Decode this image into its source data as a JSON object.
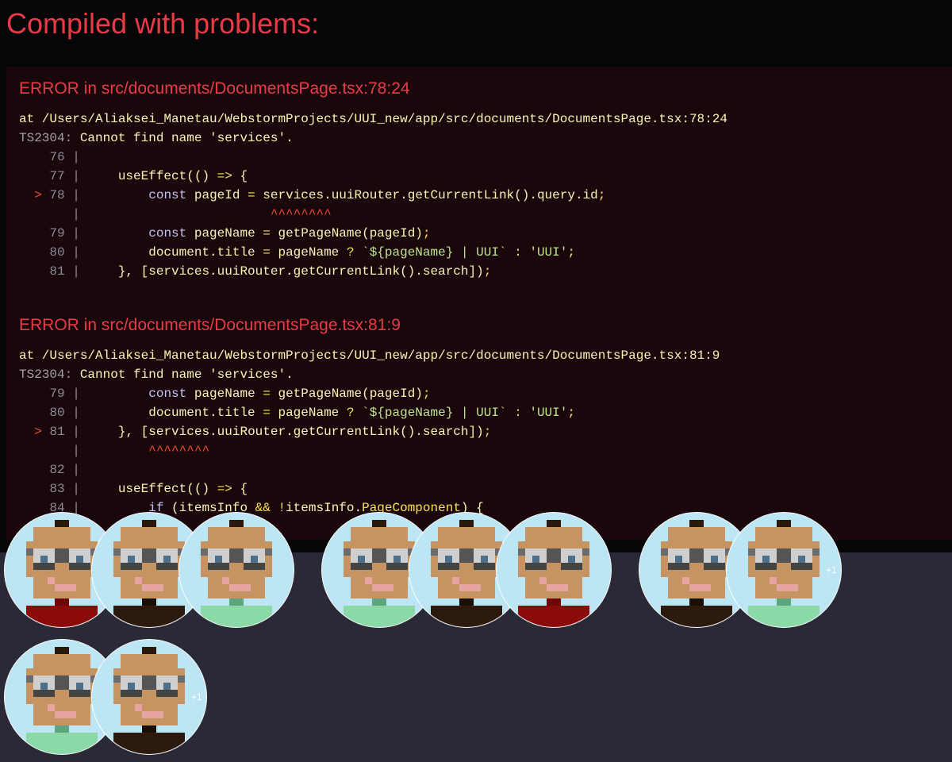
{
  "overlay": {
    "title": "Compiled with problems:",
    "errors": [
      {
        "heading": "ERROR in src/documents/DocumentsPage.tsx:78:24",
        "location": "at /Users/Aliaksei_Manetau/WebstormProjects/UUI_new/app/src/documents/DocumentsPage.tsx:78:24",
        "code": "TS2304:",
        "message": " Cannot find name 'services'.",
        "lines": [
          {
            "gutter": "    76 |",
            "segments": []
          },
          {
            "gutter": "    77 |",
            "segments": [
              {
                "t": "     useEffect(() ",
                "c": "text"
              },
              {
                "t": "=>",
                "c": "op"
              },
              {
                "t": " {",
                "c": "text"
              }
            ]
          },
          {
            "gutter": "  > 78 |",
            "marker": true,
            "segments": [
              {
                "t": "         ",
                "c": "text"
              },
              {
                "t": "const",
                "c": "kw"
              },
              {
                "t": " pageId ",
                "c": "text"
              },
              {
                "t": "=",
                "c": "op"
              },
              {
                "t": " services.uuiRouter.getCurrentLink().query.id",
                "c": "text"
              },
              {
                "t": ";",
                "c": "op"
              }
            ]
          },
          {
            "gutter": "       |",
            "segments": [
              {
                "t": "                         ^^^^^^^^",
                "c": "mark"
              }
            ]
          },
          {
            "gutter": "    79 |",
            "segments": [
              {
                "t": "         ",
                "c": "text"
              },
              {
                "t": "const",
                "c": "kw"
              },
              {
                "t": " pageName ",
                "c": "text"
              },
              {
                "t": "=",
                "c": "op"
              },
              {
                "t": " getPageName(pageId)",
                "c": "text"
              },
              {
                "t": ";",
                "c": "op"
              }
            ]
          },
          {
            "gutter": "    80 |",
            "segments": [
              {
                "t": "         document.title ",
                "c": "text"
              },
              {
                "t": "=",
                "c": "op"
              },
              {
                "t": " pageName ",
                "c": "text"
              },
              {
                "t": "?",
                "c": "op"
              },
              {
                "t": " ",
                "c": "text"
              },
              {
                "t": "`${pageName} | UUI`",
                "c": "str"
              },
              {
                "t": " : ",
                "c": "op"
              },
              {
                "t": "'UUI'",
                "c": "str"
              },
              {
                "t": ";",
                "c": "op"
              }
            ]
          },
          {
            "gutter": "    81 |",
            "segments": [
              {
                "t": "     }, [services.uuiRouter.getCurrentLink().search])",
                "c": "text"
              },
              {
                "t": ";",
                "c": "op"
              }
            ]
          }
        ]
      },
      {
        "heading": "ERROR in src/documents/DocumentsPage.tsx:81:9",
        "location": "at /Users/Aliaksei_Manetau/WebstormProjects/UUI_new/app/src/documents/DocumentsPage.tsx:81:9",
        "code": "TS2304:",
        "message": " Cannot find name 'services'.",
        "lines": [
          {
            "gutter": "    79 |",
            "segments": [
              {
                "t": "         ",
                "c": "text"
              },
              {
                "t": "const",
                "c": "kw"
              },
              {
                "t": " pageName ",
                "c": "text"
              },
              {
                "t": "=",
                "c": "op"
              },
              {
                "t": " getPageName(pageId)",
                "c": "text"
              },
              {
                "t": ";",
                "c": "op"
              }
            ]
          },
          {
            "gutter": "    80 |",
            "segments": [
              {
                "t": "         document.title ",
                "c": "text"
              },
              {
                "t": "=",
                "c": "op"
              },
              {
                "t": " pageName ",
                "c": "text"
              },
              {
                "t": "?",
                "c": "op"
              },
              {
                "t": " ",
                "c": "text"
              },
              {
                "t": "`${pageName} | UUI`",
                "c": "str"
              },
              {
                "t": " : ",
                "c": "op"
              },
              {
                "t": "'UUI'",
                "c": "str"
              },
              {
                "t": ";",
                "c": "op"
              }
            ]
          },
          {
            "gutter": "  > 81 |",
            "marker": true,
            "segments": [
              {
                "t": "     }, [services.uuiRouter.getCurrentLink().search])",
                "c": "text"
              },
              {
                "t": ";",
                "c": "op"
              }
            ]
          },
          {
            "gutter": "       |",
            "segments": [
              {
                "t": "         ^^^^^^^^",
                "c": "mark"
              }
            ]
          },
          {
            "gutter": "    82 |",
            "segments": []
          },
          {
            "gutter": "    83 |",
            "segments": [
              {
                "t": "     useEffect(() ",
                "c": "text"
              },
              {
                "t": "=>",
                "c": "op"
              },
              {
                "t": " {",
                "c": "text"
              }
            ]
          },
          {
            "gutter": "    84 |",
            "segments": [
              {
                "t": "         ",
                "c": "text"
              },
              {
                "t": "if",
                "c": "kw"
              },
              {
                "t": " (itemsInfo ",
                "c": "text"
              },
              {
                "t": "&&",
                "c": "op"
              },
              {
                "t": " ",
                "c": "text"
              },
              {
                "t": "!",
                "c": "op"
              },
              {
                "t": "itemsInfo.",
                "c": "text"
              },
              {
                "t": "PageComponent",
                "c": "op"
              },
              {
                "t": ") {",
                "c": "text"
              }
            ]
          }
        ]
      }
    ]
  },
  "colors": {
    "error_red": "#e83b46",
    "page_bg": "#292a35",
    "avatar_bg": "#bde6f4",
    "shirt_red": "#8b0a0a",
    "shirt_dark": "#2d1a0e",
    "shirt_green": "#8ad9a6"
  },
  "avatar_stacks": [
    {
      "avatars": [
        {
          "shirt": "red"
        },
        {
          "shirt": "dark"
        },
        {
          "shirt": "green"
        }
      ],
      "more": ""
    },
    {
      "avatars": [
        {
          "shirt": "green"
        },
        {
          "shirt": "dark"
        },
        {
          "shirt": "red"
        }
      ],
      "more": ""
    },
    {
      "avatars": [
        {
          "shirt": "dark"
        },
        {
          "shirt": "green"
        }
      ],
      "more": "+1"
    },
    {
      "avatars": [
        {
          "shirt": "green"
        },
        {
          "shirt": "dark"
        }
      ],
      "more": "+1"
    }
  ]
}
